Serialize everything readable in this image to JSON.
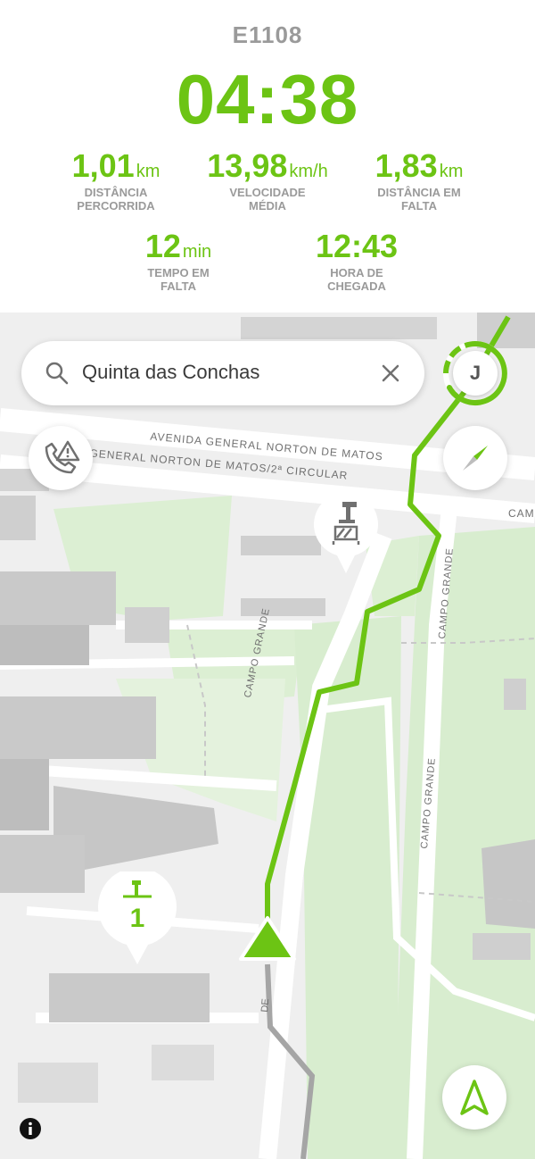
{
  "trip": {
    "id": "E1108",
    "elapsed": "04:38"
  },
  "stats": {
    "distance_traveled": {
      "value": "1,01",
      "unit": "km",
      "label": "DISTÂNCIA PERCORRIDA"
    },
    "avg_speed": {
      "value": "13,98",
      "unit": "km/h",
      "label": "VELOCIDADE MÉDIA"
    },
    "distance_remaining": {
      "value": "1,83",
      "unit": "km",
      "label": "DISTÂNCIA EM FALTA"
    },
    "time_remaining": {
      "value": "12",
      "unit": "min",
      "label": "TEMPO EM FALTA"
    },
    "arrival_time": {
      "value": "12:43",
      "unit": "",
      "label": "HORA DE CHEGADA"
    }
  },
  "search": {
    "value": "Quinta das Conchas",
    "icon": "search-icon",
    "clear_icon": "close-icon"
  },
  "avatar": {
    "initial": "J",
    "progress_ring_color": "#6cc414"
  },
  "map": {
    "streets": {
      "avenida": "AVENIDA GENERAL NORTON DE MATOS",
      "avenida2": "GENERAL NORTON DE MATOS/2ª CIRCULAR",
      "campo_grande": "CAMPO GRANDE",
      "campo_grande_2": "CAMPO GRANDE",
      "campo_grande_3": "CAMPO GRANDE",
      "partial_cam": "CAM",
      "partial_de": "DE"
    },
    "pins": {
      "dock": {
        "icon": "bike-dock-icon",
        "count": "1"
      },
      "station": {
        "icon": "station-unavailable-icon"
      }
    },
    "buttons": {
      "report": "phone-alert-icon",
      "compass": "compass-icon",
      "recenter": "navigation-arrow-icon",
      "info": "info-icon"
    }
  },
  "colors": {
    "accent": "#6cc414",
    "muted_text": "#9a9a9a"
  }
}
